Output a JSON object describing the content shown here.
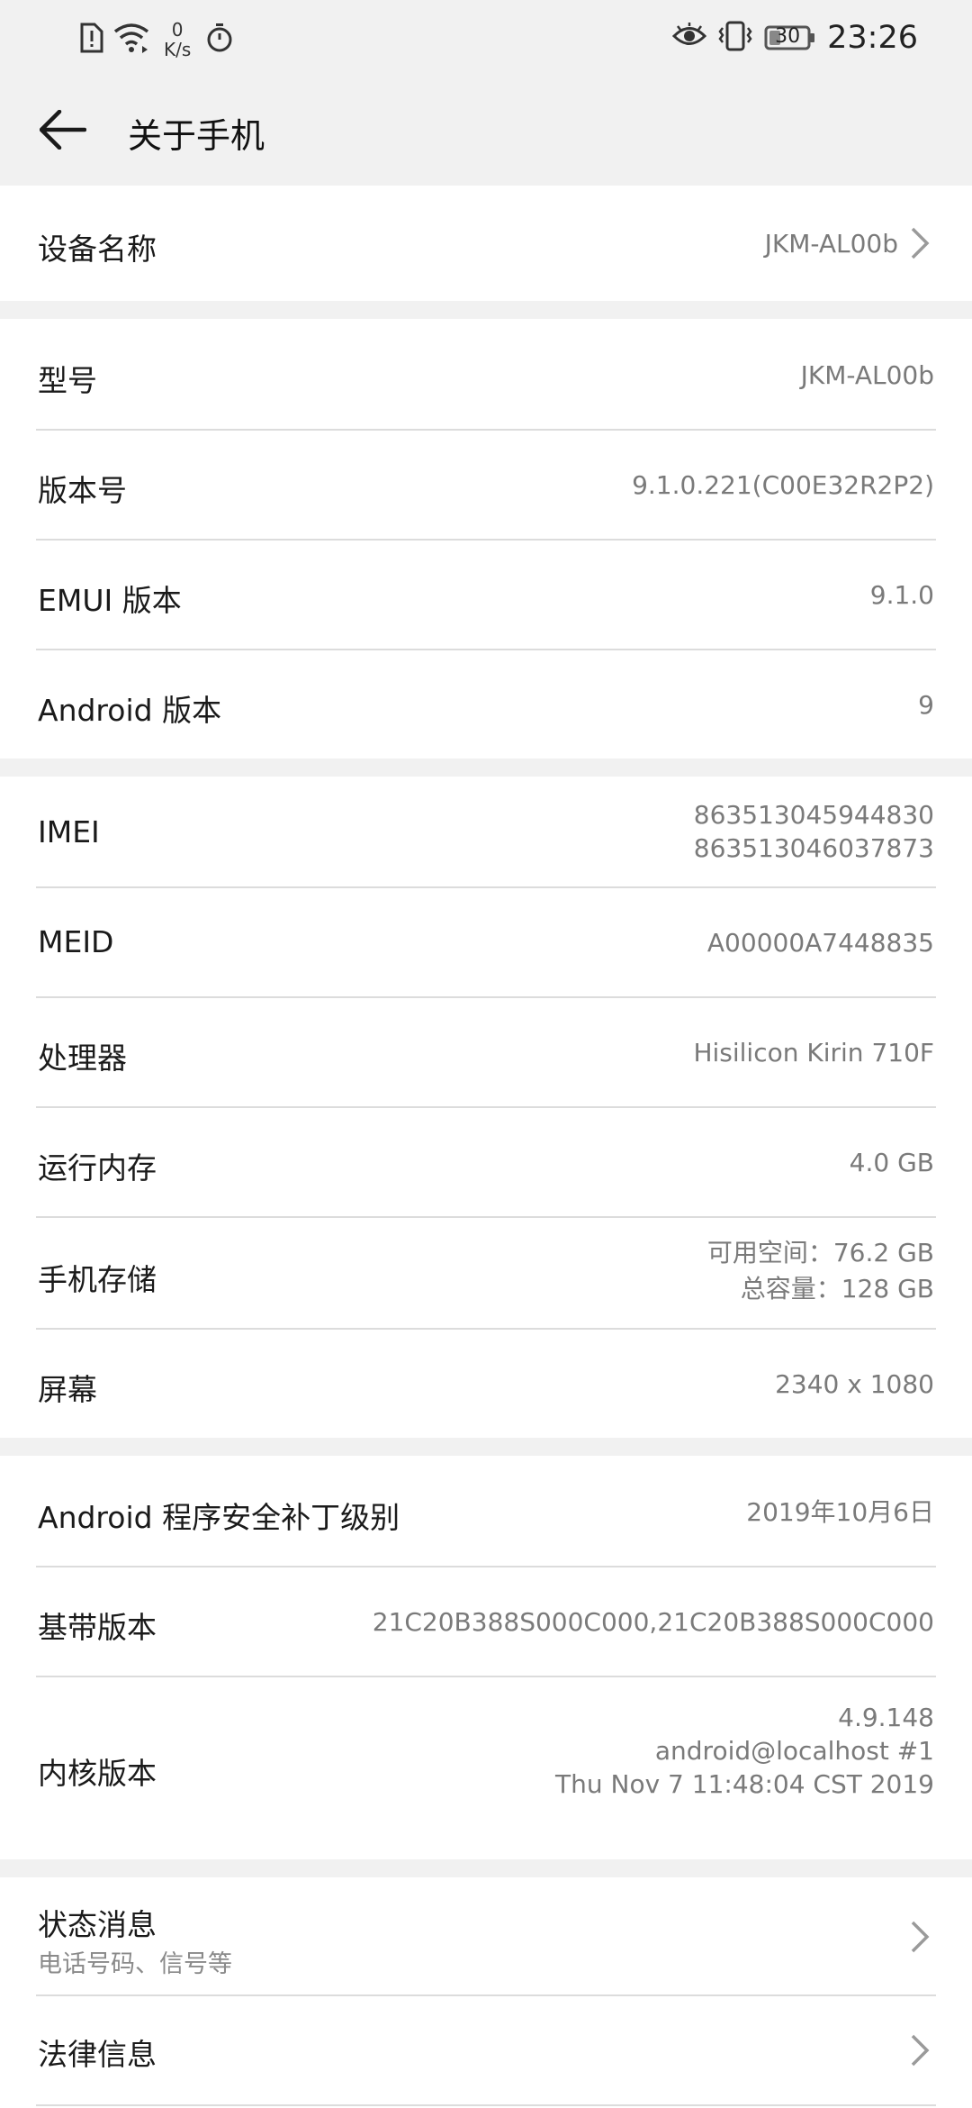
{
  "status_bar": {
    "speed_value": "0",
    "speed_unit": "K/s",
    "battery_level": "30",
    "time": "23:26",
    "icons": [
      "sim-alert-icon",
      "wifi-icon",
      "stopwatch-icon",
      "eye-icon",
      "vibrate-icon",
      "battery-icon"
    ]
  },
  "header": {
    "title": "关于手机"
  },
  "device": {
    "label": "设备名称",
    "value": "JKM-AL00b"
  },
  "software": [
    {
      "label": "型号",
      "value": "JKM-AL00b"
    },
    {
      "label": "版本号",
      "value": "9.1.0.221(C00E32R2P2)"
    },
    {
      "label": "EMUI 版本",
      "value": "9.1.0"
    },
    {
      "label": "Android 版本",
      "value": "9"
    }
  ],
  "hardware": {
    "imei": {
      "label": "IMEI",
      "value1": "863513045944830",
      "value2": "863513046037873"
    },
    "meid": {
      "label": "MEID",
      "value": "A00000A7448835"
    },
    "processor": {
      "label": "处理器",
      "value": "Hisilicon Kirin 710F"
    },
    "ram": {
      "label": "运行内存",
      "value": "4.0 GB"
    },
    "storage": {
      "label": "手机存储",
      "available": "可用空间：76.2  GB",
      "total": "总容量：128  GB"
    },
    "screen": {
      "label": "屏幕",
      "value": "2340 x 1080"
    }
  },
  "security": {
    "patch": {
      "label": "Android 程序安全补丁级别",
      "value": "2019年10月6日"
    },
    "baseband": {
      "label": "基带版本",
      "value": "21C20B388S000C000,21C20B388S000C000"
    },
    "kernel": {
      "label": "内核版本",
      "line1": "4.9.148",
      "line2": "android@localhost #1",
      "line3": "Thu Nov 7 11:48:04 CST 2019"
    }
  },
  "more": {
    "status": {
      "label": "状态消息",
      "sub": "电话号码、信号等"
    },
    "legal": {
      "label": "法律信息"
    }
  }
}
